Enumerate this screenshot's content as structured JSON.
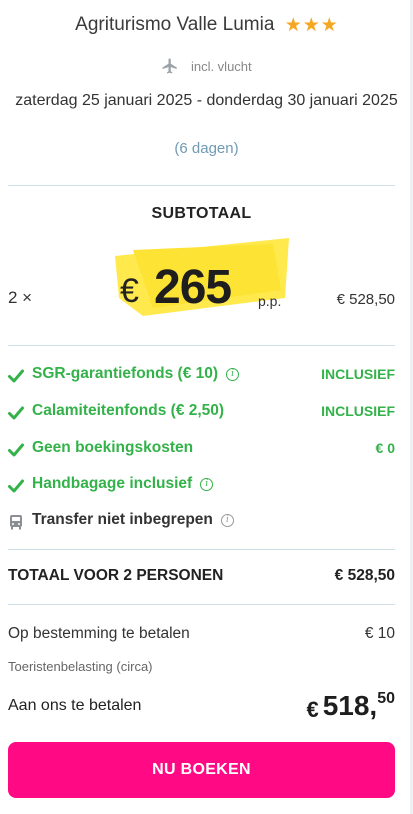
{
  "hotel": {
    "name": "Agriturismo Valle Lumia",
    "stars": 3
  },
  "flight": {
    "label": "incl. vlucht",
    "icon": "plane-icon"
  },
  "dates": {
    "range": "zaterdag 25 januari 2025 - donderdag 30 januari 2025",
    "duration": "(6 dagen)"
  },
  "subtotal": {
    "label": "SUBTOTAAL",
    "quantity": "2 ×",
    "currency": "€",
    "price_per_person": "265",
    "per_person_suffix": "p.p.",
    "amount": "€ 528,50"
  },
  "features": [
    {
      "label": "SGR-garantiefonds (€ 10)",
      "value": "INCLUSIEF",
      "icon": "check-icon",
      "info": true,
      "included": true
    },
    {
      "label": "Calamiteitenfonds (€ 2,50)",
      "value": "INCLUSIEF",
      "icon": "check-icon",
      "info": false,
      "included": true
    },
    {
      "label": "Geen boekingskosten",
      "value": "€ 0",
      "icon": "check-icon",
      "info": false,
      "included": true
    },
    {
      "label": "Handbagage inclusief",
      "value": "",
      "icon": "check-icon",
      "info": true,
      "included": true
    },
    {
      "label": "Transfer niet inbegrepen",
      "value": "",
      "icon": "bus-icon",
      "info": true,
      "included": false
    }
  ],
  "total": {
    "label": "TOTAAL VOOR 2 PERSONEN",
    "amount": "€ 528,50"
  },
  "destination": {
    "label": "Op bestemming te betalen",
    "amount": "€ 10",
    "note": "Toeristenbelasting (circa)"
  },
  "pay": {
    "label": "Aan ons te betalen",
    "currency": "€",
    "integer": "518,",
    "decimals": "50"
  },
  "cta": {
    "label": "NU BOEKEN"
  },
  "colors": {
    "accent": "#ff0a84",
    "success": "#34b24a",
    "highlight": "#ffe94d",
    "star": "#f5a623",
    "link": "#6f9bb4"
  }
}
